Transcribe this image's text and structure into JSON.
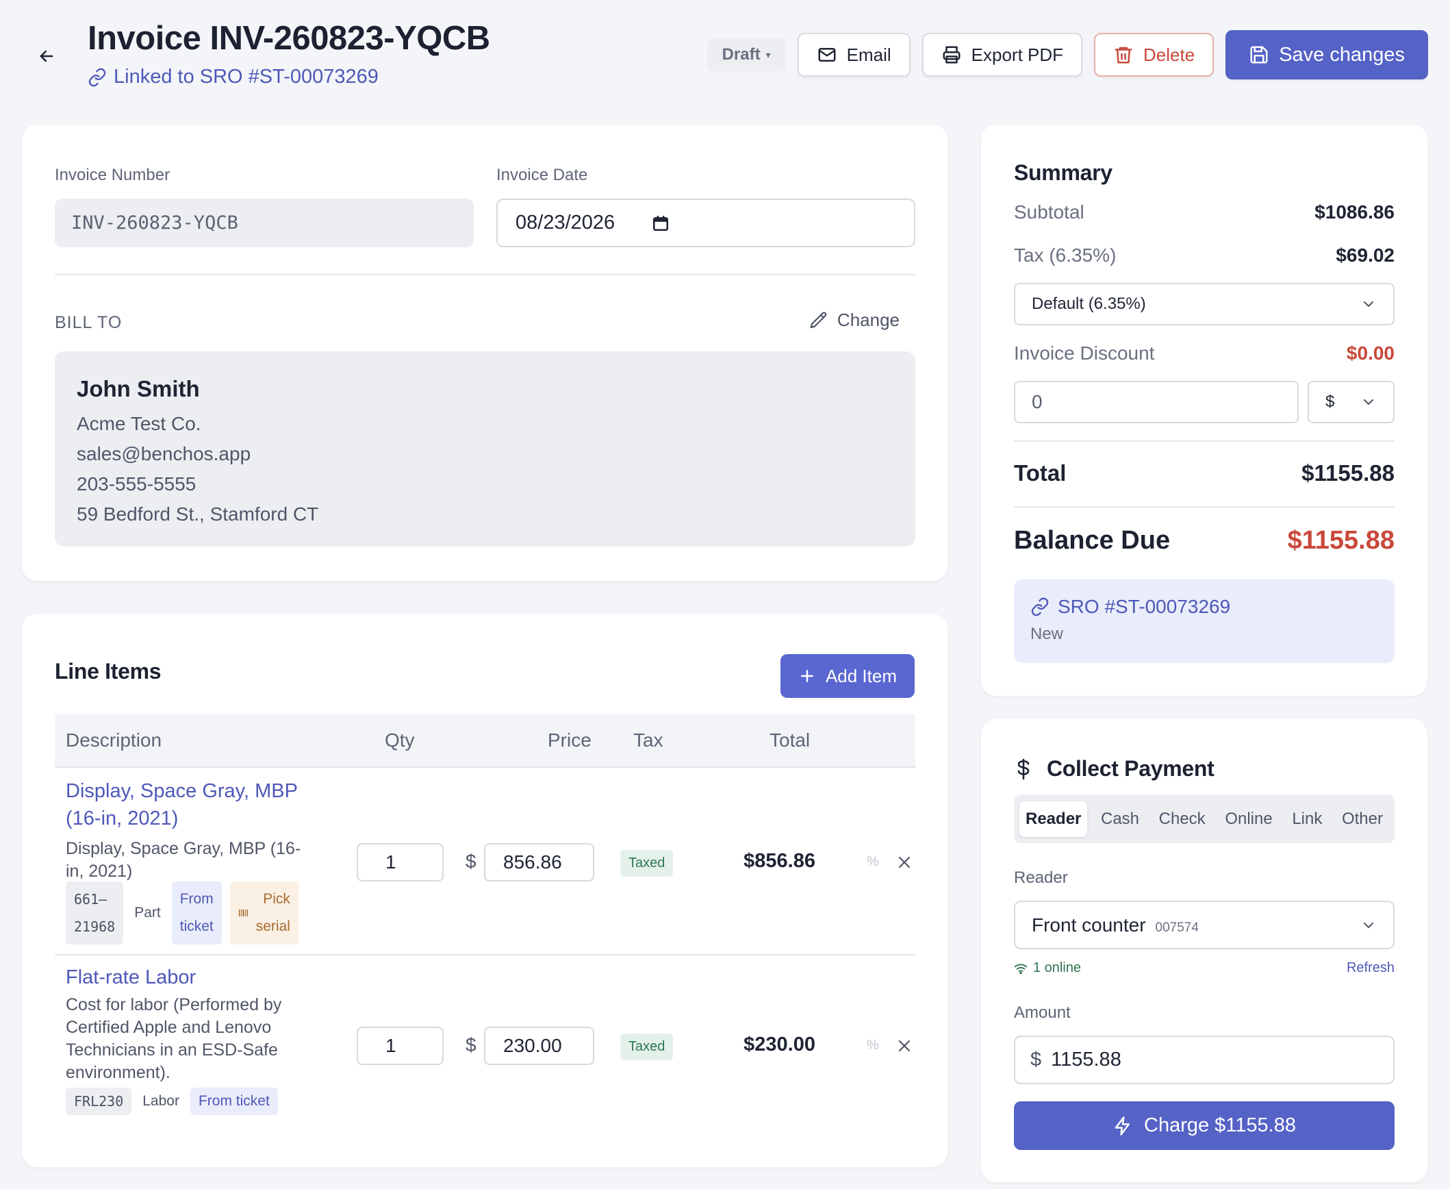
{
  "header": {
    "title": "Invoice INV-260823-YQCB",
    "linked_text": "Linked to SRO #ST-00073269",
    "status": "Draft",
    "email_label": "Email",
    "export_label": "Export PDF",
    "delete_label": "Delete",
    "save_label": "Save changes"
  },
  "invoice": {
    "number_label": "Invoice Number",
    "number_value": "INV-260823-YQCB",
    "date_label": "Invoice Date",
    "date_value": "08/23/2026"
  },
  "bill_to": {
    "label": "BILL TO",
    "change_label": "Change",
    "name": "John Smith",
    "company": "Acme Test Co.",
    "email": "sales@benchos.app",
    "phone": "203-555-5555",
    "address": "59 Bedford St., Stamford CT"
  },
  "line_items": {
    "title": "Line Items",
    "add_label": "Add Item",
    "columns": {
      "description": "Description",
      "qty": "Qty",
      "price": "Price",
      "tax": "Tax",
      "total": "Total"
    },
    "currency_symbol": "$",
    "percent_symbol": "%",
    "items": [
      {
        "name_line1": "Display, Space Gray, MBP",
        "name_line2": "(16-in, 2021)",
        "desc_line1": "Display, Space Gray, MBP (16-",
        "desc_line2": "in, 2021)",
        "sku_line1": "661–",
        "sku_line2": "21968",
        "type": "Part",
        "source_line1": "From",
        "source_line2": "ticket",
        "serial_line1": "Pick",
        "serial_line2": "serial",
        "qty": "1",
        "price": "856.86",
        "tax": "Taxed",
        "total": "$856.86"
      },
      {
        "name_line1": "Flat-rate Labor",
        "desc_line1": "Cost for labor (Performed by",
        "desc_line2": "Certified Apple and Lenovo",
        "desc_line3": "Technicians in an ESD-Safe",
        "desc_line4": "environment).",
        "sku": "FRL230",
        "type": "Labor",
        "source": "From ticket",
        "qty": "1",
        "price": "230.00",
        "tax": "Taxed",
        "total": "$230.00"
      }
    ]
  },
  "summary": {
    "title": "Summary",
    "subtotal_label": "Subtotal",
    "subtotal_value": "$1086.86",
    "tax_label": "Tax (6.35%)",
    "tax_value": "$69.02",
    "tax_select": "Default (6.35%)",
    "discount_label": "Invoice Discount",
    "discount_value": "$0.00",
    "discount_input": "0",
    "discount_unit": "$",
    "total_label": "Total",
    "total_value": "$1155.88",
    "balance_label": "Balance Due",
    "balance_value": "$1155.88",
    "sro_link": "SRO #ST-00073269",
    "sro_status": "New"
  },
  "payment": {
    "title": "Collect Payment",
    "tabs": [
      "Reader",
      "Cash",
      "Check",
      "Online",
      "Link",
      "Other"
    ],
    "reader_label": "Reader",
    "reader_name": "Front counter",
    "reader_id": "007574",
    "online_status": "1 online",
    "refresh_label": "Refresh",
    "amount_label": "Amount",
    "amount_currency": "$",
    "amount_value": "1155.88",
    "charge_label": "Charge $1155.88"
  },
  "colors": {
    "primary": "#5562c6",
    "link": "#4d58b8",
    "danger": "#c9483a",
    "success": "#2f7650"
  }
}
